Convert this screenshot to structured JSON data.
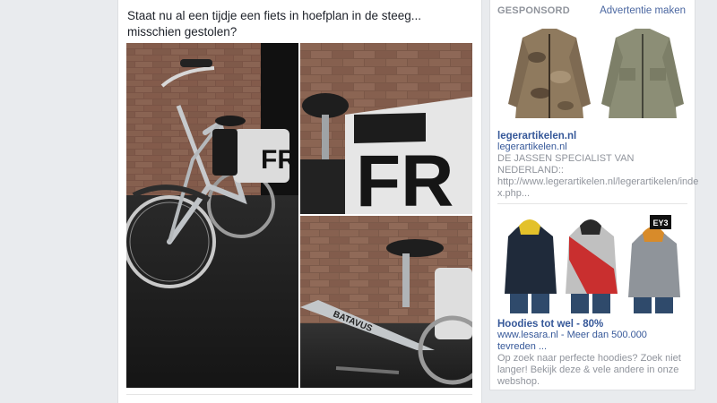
{
  "post": {
    "text": "Staat nu al een tijdje een fiets in hoefplan in de steeg... misschien gestolen?",
    "photo_bag_letters": "FR",
    "photo_frame_brand": "BATAVUS"
  },
  "sidebar": {
    "title": "GESPONSORD",
    "create_ad": "Advertentie maken",
    "ads": [
      {
        "title": "legerartikelen.nl",
        "domain": "legerartikelen.nl",
        "body": "DE JASSEN SPECIALIST VAN NEDERLAND:: http://www.legerartikelen.nl/legerartikelen/inde x.php..."
      },
      {
        "title": "Hoodies tot wel - 80%",
        "domain": "www.lesara.nl - Meer dan 500.000 tevreden ...",
        "body": "Op zoek naar perfecte hoodies? Zoek niet langer! Bekijk deze & vele andere in onze webshop.",
        "badge": "EY3"
      }
    ]
  },
  "colors": {
    "link": "#365899",
    "muted": "#90949c",
    "background": "#e9ebee"
  }
}
